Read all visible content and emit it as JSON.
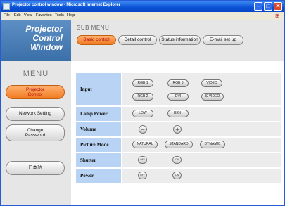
{
  "window": {
    "title": "Projector control window - Microsoft Internet Explorer",
    "min_glyph": "–",
    "max_glyph": "□",
    "close_glyph": "✕"
  },
  "menubar": [
    "File",
    "Edit",
    "View",
    "Favorites",
    "Tools",
    "Help"
  ],
  "logo": {
    "line1": "Projector",
    "line2": "Control",
    "line3": "Window"
  },
  "sidebar": {
    "heading": "MENU",
    "items": [
      {
        "line1": "Projector",
        "line2": "Control",
        "active": true
      },
      {
        "line1": "Network Setting",
        "line2": "",
        "active": false
      },
      {
        "line1": "Change",
        "line2": "Password",
        "active": false
      },
      {
        "line1": "日本語",
        "line2": "",
        "active": false
      }
    ]
  },
  "submenu": {
    "label": "SUB MENU",
    "tabs": [
      {
        "label": "Basic control",
        "active": true
      },
      {
        "label": "Detail control",
        "active": false
      },
      {
        "label": "Status information",
        "active": false
      },
      {
        "label": "E-mail set up",
        "active": false
      }
    ]
  },
  "controls": {
    "input": {
      "label": "Input",
      "buttons": [
        "RGB 1",
        "RGB 3",
        "VIDEO",
        "RGB 2",
        "DVI",
        "S-VIDEO"
      ]
    },
    "lamp_power": {
      "label": "Lamp Power",
      "buttons": [
        "LOW",
        "HIGH"
      ]
    },
    "volume": {
      "label": "Volume",
      "buttons": [
        "−",
        "+"
      ]
    },
    "picture_mode": {
      "label": "Picture Mode",
      "buttons": [
        "NATURAL",
        "STANDARD",
        "DYNAMIC"
      ]
    },
    "shutter": {
      "label": "Shutter",
      "buttons": [
        "OFF",
        "ON"
      ]
    },
    "power": {
      "label": "Power",
      "buttons": [
        "OFF",
        "ON"
      ]
    }
  }
}
